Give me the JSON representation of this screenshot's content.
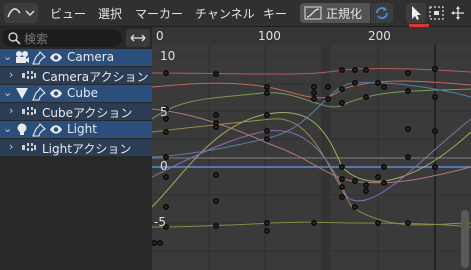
{
  "header": {
    "menus": [
      "ビュー",
      "選択",
      "マーカー",
      "チャンネル",
      "キー"
    ],
    "normalize_label": "正規化"
  },
  "outliner": {
    "search_placeholder": "検索",
    "items": [
      {
        "label": "Camera",
        "type": "object",
        "icon": "camera-icon"
      },
      {
        "label": "Cameraアクション",
        "type": "action",
        "icon": "action-icon"
      },
      {
        "label": "Cube",
        "type": "object",
        "icon": "mesh-icon"
      },
      {
        "label": "Cubeアクション",
        "type": "action",
        "icon": "action-icon"
      },
      {
        "label": "Light",
        "type": "object",
        "icon": "light-icon"
      },
      {
        "label": "Lightアクション",
        "type": "action",
        "icon": "action-icon"
      }
    ]
  },
  "graph": {
    "frame_labels": [
      "0",
      "100",
      "200"
    ],
    "value_labels": [
      "10",
      "5",
      "0",
      "-5"
    ],
    "colors": {
      "background": "#3a3a3a",
      "selected_row": "#2b4f7d",
      "action_row": "#2b3c55",
      "accent_red": "#e03333",
      "zero_line": "#5b8fd9"
    }
  }
}
